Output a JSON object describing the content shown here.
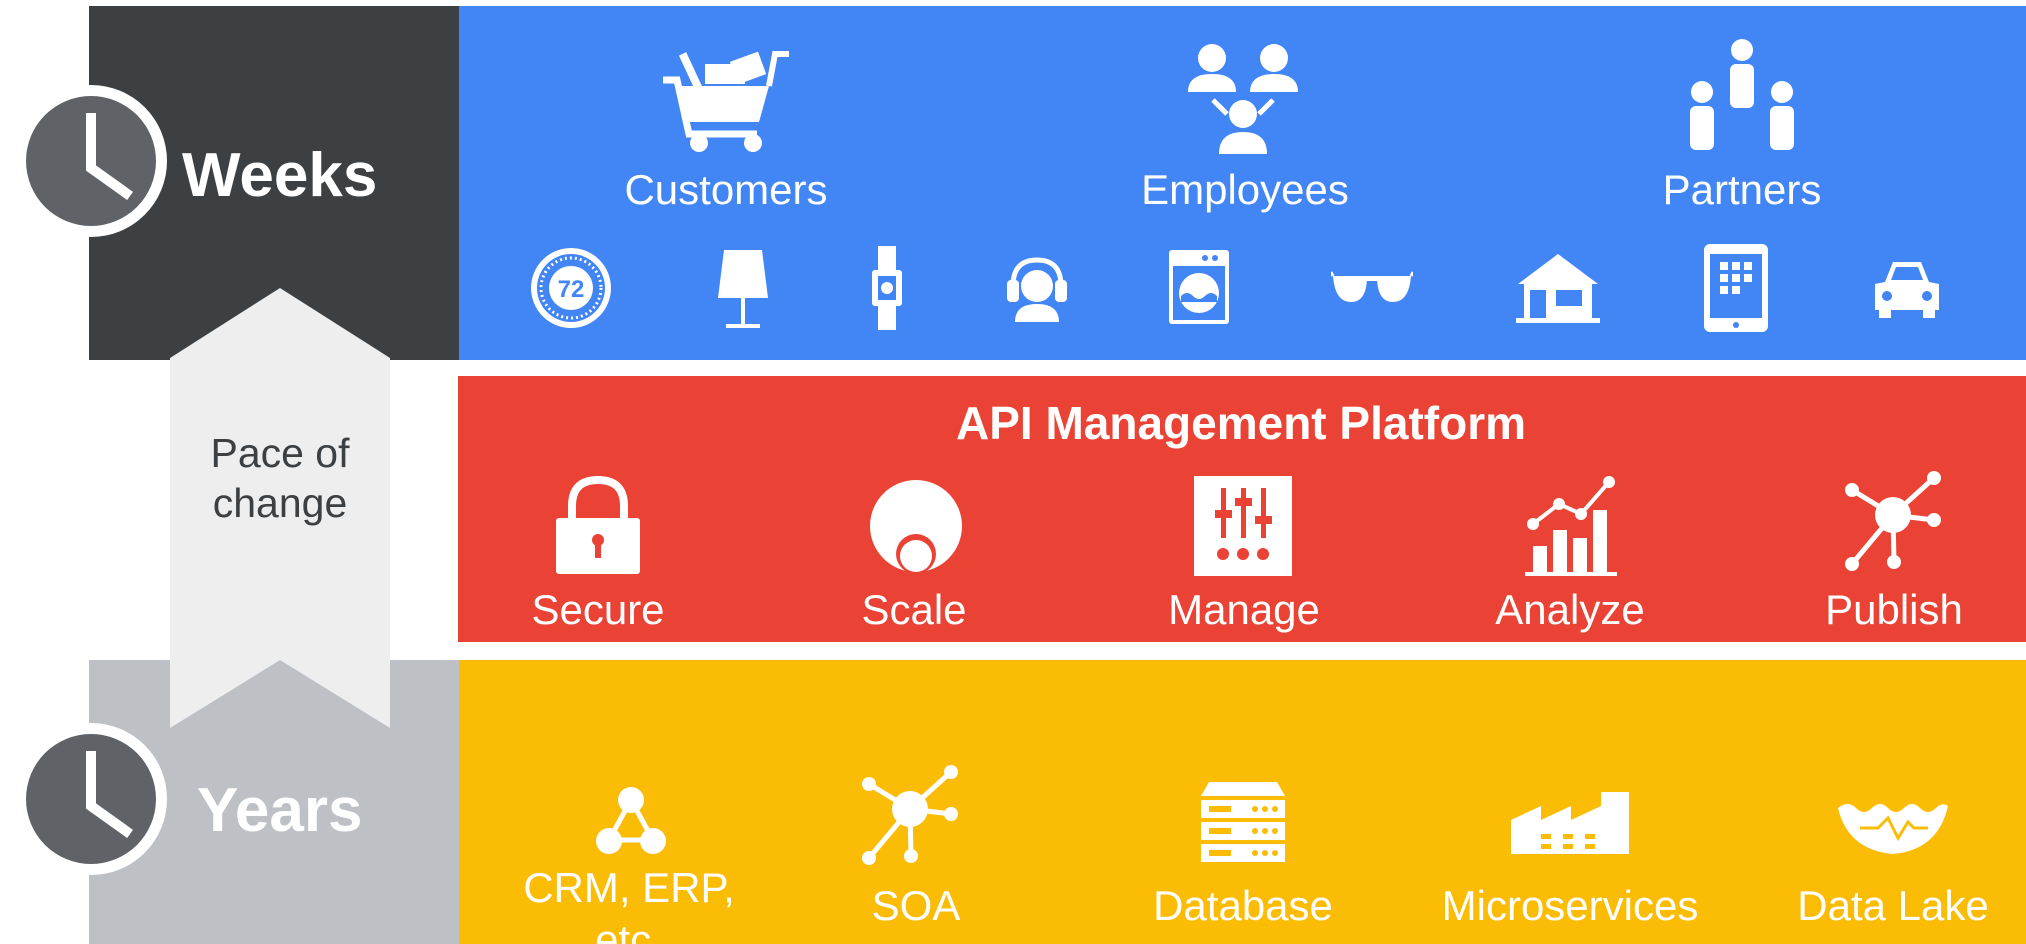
{
  "left": {
    "weeks_label": "Weeks",
    "years_label": "Years",
    "pace_line1": "Pace of",
    "pace_line2": "change",
    "colors": {
      "dark": "#3c4043",
      "light": "#bdc1c6",
      "arrow": "#eeeeee",
      "clock": "#5f6368"
    }
  },
  "top_band": {
    "color": "#4285f4",
    "groups": [
      {
        "label": "Customers",
        "icon": "shopping-cart-icon"
      },
      {
        "label": "Employees",
        "icon": "people-network-icon"
      },
      {
        "label": "Partners",
        "icon": "partners-icon"
      }
    ],
    "devices": [
      {
        "icon": "thermostat-icon",
        "text": "72"
      },
      {
        "icon": "lamp-icon"
      },
      {
        "icon": "smartwatch-icon"
      },
      {
        "icon": "headset-person-icon"
      },
      {
        "icon": "washing-machine-icon"
      },
      {
        "icon": "glasses-icon"
      },
      {
        "icon": "house-icon"
      },
      {
        "icon": "tablet-icon"
      },
      {
        "icon": "car-icon"
      }
    ]
  },
  "middle_band": {
    "color": "#ea4335",
    "title": "API Management Platform",
    "items": [
      {
        "label": "Secure",
        "icon": "padlock-icon"
      },
      {
        "label": "Scale",
        "icon": "scale-circles-icon"
      },
      {
        "label": "Manage",
        "icon": "sliders-icon"
      },
      {
        "label": "Analyze",
        "icon": "analytics-chart-icon"
      },
      {
        "label": "Publish",
        "icon": "hub-network-icon"
      }
    ]
  },
  "bottom_band": {
    "color": "#fbbc05",
    "items": [
      {
        "label": "CRM, ERP,\netc.",
        "icon": "triangle-nodes-icon"
      },
      {
        "label": "SOA",
        "icon": "hub-network-icon"
      },
      {
        "label": "Database",
        "icon": "server-rack-icon"
      },
      {
        "label": "Microservices",
        "icon": "factory-icon"
      },
      {
        "label": "Data Lake",
        "icon": "lake-icon"
      }
    ]
  }
}
